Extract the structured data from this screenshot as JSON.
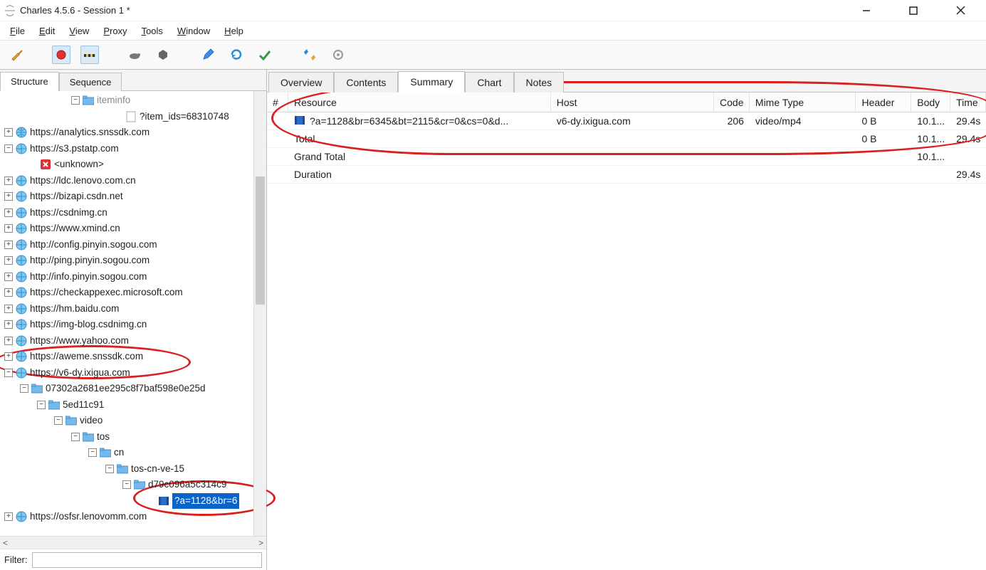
{
  "window": {
    "title": "Charles 4.5.6 - Session 1 *"
  },
  "menu": {
    "file": "File",
    "edit": "Edit",
    "view": "View",
    "proxy": "Proxy",
    "tools": "Tools",
    "window": "Window",
    "help": "Help"
  },
  "left_tabs": {
    "structure": "Structure",
    "sequence": "Sequence"
  },
  "filter": {
    "label": "Filter:",
    "value": ""
  },
  "tree": {
    "iteminfo": "iteminfo",
    "item_ids": "?item_ids=68310748",
    "hosts": [
      "https://analytics.snssdk.com",
      "https://s3.pstatp.com",
      "<unknown>",
      "https://ldc.lenovo.com.cn",
      "https://bizapi.csdn.net",
      "https://csdnimg.cn",
      "https://www.xmind.cn",
      "http://config.pinyin.sogou.com",
      "http://ping.pinyin.sogou.com",
      "http://info.pinyin.sogou.com",
      "https://checkappexec.microsoft.com",
      "https://hm.baidu.com",
      "https://img-blog.csdnimg.cn",
      "https://www.yahoo.com",
      "https://aweme.snssdk.com",
      "https://v6-dy.ixigua.com"
    ],
    "ixigua_child": "07302a2681ee295c8f7baf598e0e25d",
    "path": [
      "5ed11c91",
      "video",
      "tos",
      "cn",
      "tos-cn-ve-15",
      "d79c096a5c314c9"
    ],
    "leaf": "?a=1128&br=6",
    "last_host": "https://osfsr.lenovomm.com"
  },
  "right_tabs": {
    "overview": "Overview",
    "contents": "Contents",
    "summary": "Summary",
    "chart": "Chart",
    "notes": "Notes"
  },
  "table": {
    "headers": {
      "num": "#",
      "resource": "Resource",
      "host": "Host",
      "code": "Code",
      "mime": "Mime Type",
      "header": "Header",
      "body": "Body",
      "time": "Time"
    },
    "row": {
      "resource": "?a=1128&br=6345&bt=2115&cr=0&cs=0&d...",
      "host": "v6-dy.ixigua.com",
      "code": "206",
      "mime": "video/mp4",
      "header": "0 B",
      "body": "10.1...",
      "time": "29.4s"
    },
    "total_label": "Total",
    "total": {
      "header": "0 B",
      "body": "10.1...",
      "time": "29.4s"
    },
    "grand_total_label": "Grand Total",
    "grand_total": {
      "body": "10.1..."
    },
    "duration_label": "Duration",
    "duration": {
      "time": "29.4s"
    }
  }
}
